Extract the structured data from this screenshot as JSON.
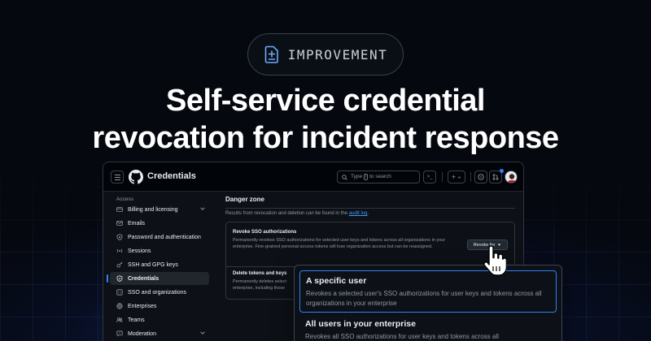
{
  "badge": {
    "label": "IMPROVEMENT",
    "icon": "diff-added-icon"
  },
  "headline": {
    "line1": "Self-service credential",
    "line2": "revocation for incident response"
  },
  "app": {
    "title": "Credentials",
    "search_placeholder": "Type",
    "search_key": "/",
    "search_suffix": "to search",
    "terminal_key": ">_",
    "new_label": "+"
  },
  "sidebar": {
    "heading": "Access",
    "items": [
      {
        "label": "Billing and licensing",
        "icon": "credit-card-icon",
        "has_caret": true
      },
      {
        "label": "Emails",
        "icon": "mail-icon"
      },
      {
        "label": "Password and authentication",
        "icon": "shield-lock-icon"
      },
      {
        "label": "Sessions",
        "icon": "broadcast-icon"
      },
      {
        "label": "SSH and GPG keys",
        "icon": "key-icon"
      },
      {
        "label": "Credentials",
        "icon": "shield-icon",
        "active": true
      },
      {
        "label": "SSO and organizations",
        "icon": "organization-icon"
      },
      {
        "label": "Enterprises",
        "icon": "globe-icon"
      },
      {
        "label": "Teams",
        "icon": "people-icon"
      },
      {
        "label": "Moderation",
        "icon": "report-icon",
        "has_caret": true
      }
    ]
  },
  "main": {
    "title": "Danger zone",
    "info_prefix": "Results from revocation and deletion can be found in the",
    "info_link": "audit log",
    "info_suffix": ".",
    "sso": {
      "title": "Revoke SSO authorizations",
      "desc": "Permanently revokes SSO authorizations for selected user keys and tokens across all organizations in your enterprise. Fine-grained personal access tokens will lose organization access but can be reassigned.",
      "button": "Revoke for"
    },
    "delete": {
      "title": "Delete tokens and keys",
      "desc_line1": "Permanently deletes select",
      "desc_line2": "enterprise, including those"
    }
  },
  "dropdown": {
    "options": [
      {
        "title": "A specific user",
        "desc": "Revokes a selected user's SSO authorizations for user keys and tokens across all organizations in your enterprise",
        "selected": true
      },
      {
        "title": "All users in your enterprise",
        "desc": "Revokes all SSO authorizations for user keys and tokens across all"
      }
    ]
  },
  "colors": {
    "accent": "#2f81f7",
    "background": "#05080f",
    "panel": "#0d1117",
    "border": "#30363d"
  }
}
